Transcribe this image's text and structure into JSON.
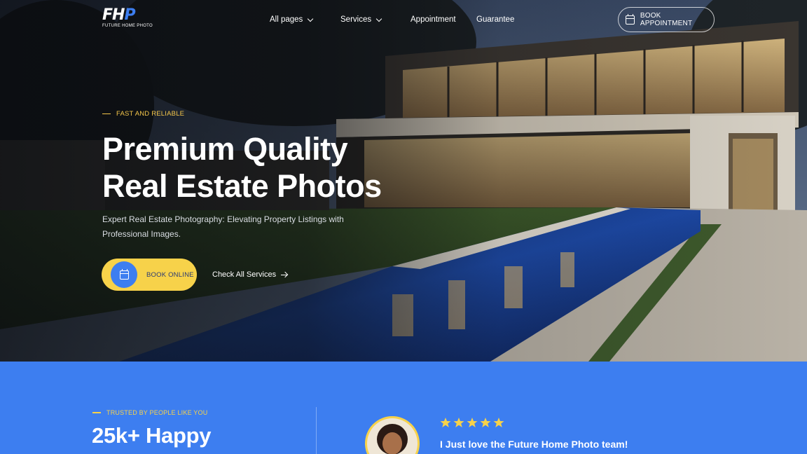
{
  "brand": {
    "logo_letters": "FHP",
    "logo_subtitle": "FUTURE HOME PHOTO"
  },
  "nav": {
    "items": [
      {
        "label": "All pages",
        "has_dropdown": true
      },
      {
        "label": "Services",
        "has_dropdown": true
      },
      {
        "label": "Appointment",
        "has_dropdown": false
      },
      {
        "label": "Guarantee",
        "has_dropdown": false
      }
    ],
    "cta_label": "BOOK APPOINTMENT"
  },
  "hero": {
    "eyebrow": "FAST AND RELIABLE",
    "title_line1": "Premium Quality",
    "title_line2": "Real Estate Photos",
    "description": "Expert Real Estate Photography: Elevating Property Listings with Professional Images.",
    "book_button_label": "BOOK ONLINE",
    "services_link_label": "Check All Services"
  },
  "trust": {
    "eyebrow": "TRUSTED BY PEOPLE LIKE YOU",
    "headline": "25k+ Happy",
    "rating_stars": 5,
    "testimonial_quote": "I Just love the Future Home Photo team!"
  },
  "colors": {
    "accent_blue": "#3d7ef0",
    "accent_yellow": "#f7d24a",
    "eyebrow_gold": "#f4c64a"
  }
}
